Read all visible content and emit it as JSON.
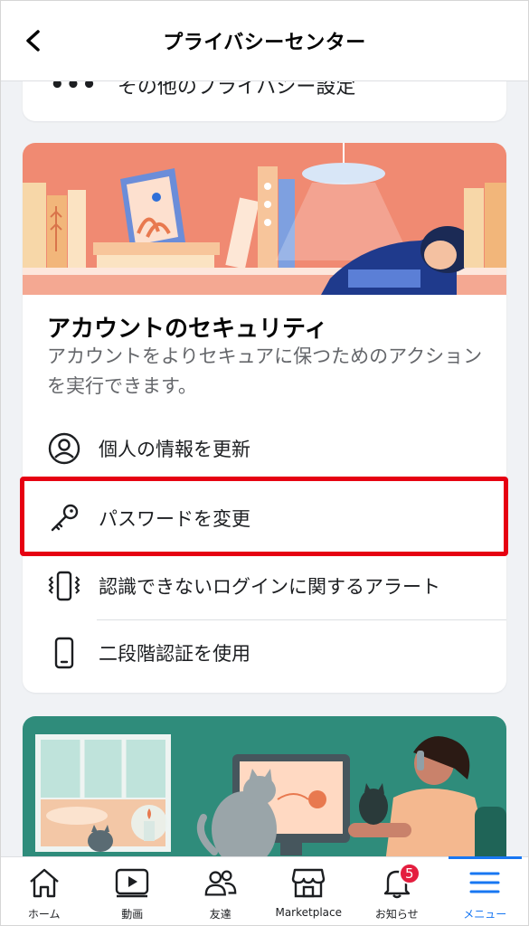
{
  "header": {
    "title": "プライバシーセンター",
    "back_icon": "chevron-left-icon"
  },
  "top_card": {
    "label": "その他のプライバシー設定",
    "icon": "more-dots-icon"
  },
  "security": {
    "title": "アカウントのセキュリティ",
    "description": "アカウントをよりセキュアに保つためのアクションを実行できます。",
    "items": [
      {
        "label": "個人の情報を更新",
        "icon": "person-circle-icon"
      },
      {
        "label": "パスワードを変更",
        "icon": "key-icon"
      },
      {
        "label": "認識できないログインに関するアラート",
        "icon": "phone-vibrate-icon"
      },
      {
        "label": "二段階認証を使用",
        "icon": "phone-icon"
      }
    ]
  },
  "tabbar": {
    "tabs": [
      {
        "label": "ホーム",
        "icon": "home-icon"
      },
      {
        "label": "動画",
        "icon": "video-icon"
      },
      {
        "label": "友達",
        "icon": "friends-icon"
      },
      {
        "label": "Marketplace",
        "icon": "marketplace-icon"
      },
      {
        "label": "お知らせ",
        "icon": "bell-icon",
        "badge": "5"
      },
      {
        "label": "メニュー",
        "icon": "menu-icon",
        "active": true
      }
    ]
  },
  "colors": {
    "accent": "#1877f2",
    "highlight": "#e60012",
    "badge": "#e41e3f",
    "banner_coral": "#f08a72",
    "banner_teal": "#2f8c7b"
  }
}
